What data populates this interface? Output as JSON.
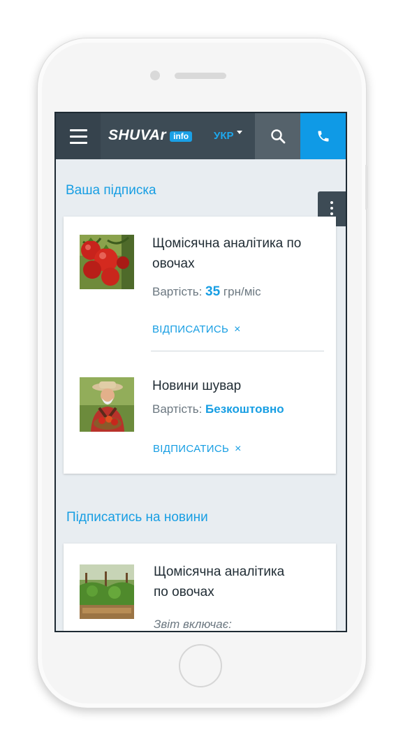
{
  "header": {
    "logo_text": "SHUVAr",
    "logo_badge": "info",
    "language": "УКР"
  },
  "my_subscription": {
    "title": "Ваша підписка",
    "items": [
      {
        "title_line1": "Щомісячна аналітика по",
        "title_line2": "овочах",
        "price_label": "Вартість:",
        "price_value": "35",
        "price_unit": "грн/міс",
        "unsubscribe_label": "ВІДПИСАТИСЬ",
        "unsubscribe_icon": "×"
      },
      {
        "title_line1": "Новини шувар",
        "price_label": "Вартість:",
        "price_value": "Безкоштовно",
        "unsubscribe_label": "ВІДПИСАТИСЬ",
        "unsubscribe_icon": "×"
      }
    ]
  },
  "subscribe_news": {
    "title": "Підписатись на новини",
    "items": [
      {
        "title_line1": "Щомісячна аналітика",
        "title_line2": "по овочах",
        "includes_label": "Звіт включає:"
      }
    ]
  },
  "colors": {
    "accent": "#179ee3",
    "header_bg": "#3d4b55",
    "call_button": "#0f9ae6",
    "page_bg": "#e8edf1"
  }
}
